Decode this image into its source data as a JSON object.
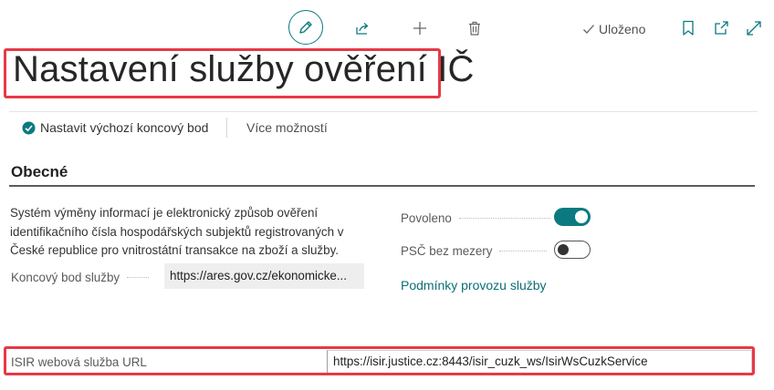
{
  "toolbar": {
    "icons": [
      "edit-icon",
      "share-icon",
      "add-icon",
      "delete-icon"
    ],
    "status": "Uloženo",
    "right_icons": [
      "bookmark-icon",
      "open-new-window-icon",
      "expand-icon"
    ]
  },
  "page": {
    "title": "Nastavení služby ověření IČ"
  },
  "actions": {
    "set_default_endpoint": "Nastavit výchozí koncový bod",
    "more_options": "Více možností"
  },
  "section": {
    "title": "Obecné",
    "description": "Systém výměny informací je elektronický způsob ověření identifikačního čísla hospodářských subjektů registrovaných v České republice pro vnitrostátní transakce na zboží a služby.",
    "endpoint_label": "Koncový bod služby",
    "endpoint_value": "https://ares.gov.cz/ekonomicke...",
    "enabled_label": "Povoleno",
    "enabled_value": true,
    "postcode_label": "PSČ bez mezery",
    "postcode_value": false,
    "terms_link": "Podmínky provozu služby",
    "isir_label": "ISIR webová služba URL",
    "isir_value": "https://isir.justice.cz:8443/isir_cuzk_ws/IsirWsCuzkService"
  },
  "colors": {
    "accent": "#0b7a80",
    "highlight": "#e63946"
  }
}
